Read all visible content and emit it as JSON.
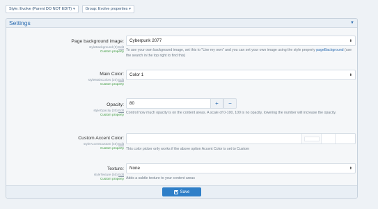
{
  "topbar": {
    "style_label": "Style: Evolve (Parent DO NOT EDIT)",
    "group_label": "Group: Evolve properties"
  },
  "panel": {
    "title": "Settings"
  },
  "properties": [
    {
      "label": "Page background image:",
      "sub": "styleBackground (0)",
      "edit": "Edit",
      "custom": "Custom property",
      "value": "Cyberpunk 2077",
      "hint_pre": "To use your own background image, set this to \"Use my own\" and you can set your own image using the style property ",
      "hint_link": "pageBackground",
      "hint_post": " (use the search in the top right to find this)"
    },
    {
      "label": "Main Color:",
      "sub": "styleMainColors (20)",
      "edit": "Edit",
      "custom": "Custom property",
      "value": "Color 1"
    },
    {
      "label": "Opacity:",
      "sub": "styleOpacity (30)",
      "edit": "Edit",
      "custom": "Custom property",
      "value": "80",
      "plus": "+",
      "minus": "−",
      "hint": "Control how much opacity is on the content areas. A scale of 0-100, 100 is no opacity, lowering the number will increase the opacity."
    },
    {
      "label": "Custom Accent Color:",
      "sub": "styleAccentCustom (40)",
      "edit": "Edit",
      "custom": "Custom property",
      "hint": "This color picker only works if the above option Accent Color is set to Custom"
    },
    {
      "label": "Texture:",
      "sub": "styleTexture (50)",
      "edit": "Edit",
      "custom": "Custom property",
      "value": "None",
      "hint": "Adds a subtle texture to your content areas"
    }
  ],
  "footer": {
    "save_label": "Save"
  },
  "colors": {
    "accent": "#2f7fc8",
    "link": "#2a6bb0",
    "custom_property": "#3b9a3b"
  }
}
